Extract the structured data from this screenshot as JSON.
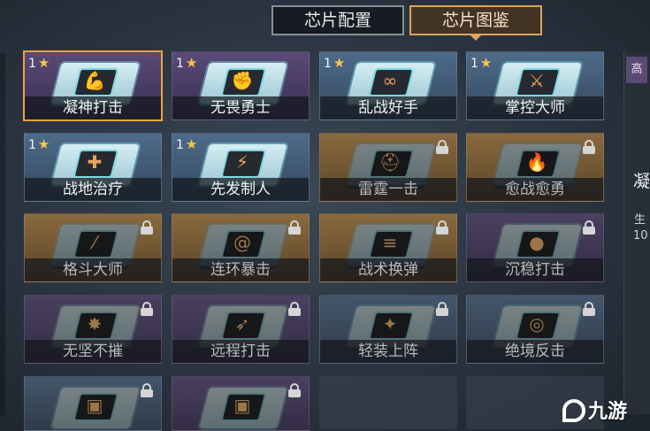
{
  "tabs": [
    {
      "label": "芯片配置",
      "active": false
    },
    {
      "label": "芯片图鉴",
      "active": true
    }
  ],
  "chips": [
    {
      "name": "凝神打击",
      "level": "1",
      "rarity": "purple",
      "locked": false,
      "selected": true,
      "icon": "flexed-arm-icon"
    },
    {
      "name": "无畏勇士",
      "level": "1",
      "rarity": "purple",
      "locked": false,
      "selected": false,
      "icon": "fist-icon"
    },
    {
      "name": "乱战好手",
      "level": "1",
      "rarity": "blue",
      "locked": false,
      "selected": false,
      "icon": "loop-icon"
    },
    {
      "name": "掌控大师",
      "level": "1",
      "rarity": "blue",
      "locked": false,
      "selected": false,
      "icon": "claw-icon"
    },
    {
      "name": "战地治疗",
      "level": "1",
      "rarity": "blue",
      "locked": false,
      "selected": false,
      "icon": "medkit-icon"
    },
    {
      "name": "先发制人",
      "level": "1",
      "rarity": "blue",
      "locked": false,
      "selected": false,
      "icon": "lightning-icon"
    },
    {
      "name": "雷霆一击",
      "level": "",
      "rarity": "gold",
      "locked": true,
      "selected": false,
      "icon": "helmet-icon"
    },
    {
      "name": "愈战愈勇",
      "level": "",
      "rarity": "gold",
      "locked": true,
      "selected": false,
      "icon": "flame-icon"
    },
    {
      "name": "格斗大师",
      "level": "",
      "rarity": "gold",
      "locked": true,
      "selected": false,
      "icon": "slash-icon"
    },
    {
      "name": "连环暴击",
      "level": "",
      "rarity": "gold",
      "locked": true,
      "selected": false,
      "icon": "spiral-icon"
    },
    {
      "name": "战术换弹",
      "level": "",
      "rarity": "gold",
      "locked": true,
      "selected": false,
      "icon": "magazine-icon"
    },
    {
      "name": "沉稳打击",
      "level": "",
      "rarity": "purple",
      "locked": true,
      "selected": false,
      "icon": "grenade-icon"
    },
    {
      "name": "无坚不摧",
      "level": "",
      "rarity": "purple",
      "locked": true,
      "selected": false,
      "icon": "explosion-icon"
    },
    {
      "name": "远程打击",
      "level": "",
      "rarity": "purple",
      "locked": true,
      "selected": false,
      "icon": "bird-icon"
    },
    {
      "name": "轻装上阵",
      "level": "",
      "rarity": "blue",
      "locked": true,
      "selected": false,
      "icon": "runner-icon"
    },
    {
      "name": "绝境反击",
      "level": "",
      "rarity": "blue",
      "locked": true,
      "selected": false,
      "icon": "target-icon"
    },
    {
      "name": "",
      "level": "",
      "rarity": "blue",
      "locked": true,
      "selected": false,
      "icon": "chip-icon"
    },
    {
      "name": "",
      "level": "",
      "rarity": "purple",
      "locked": true,
      "selected": false,
      "icon": "chip-icon"
    }
  ],
  "side_panel": {
    "tag": "高",
    "title": "凝",
    "label": "生",
    "value": "10"
  },
  "watermark": "九游",
  "colors": {
    "selected_outline": "#f0a040",
    "star": "#f5c64a",
    "active_tab": "#e0a35a"
  }
}
